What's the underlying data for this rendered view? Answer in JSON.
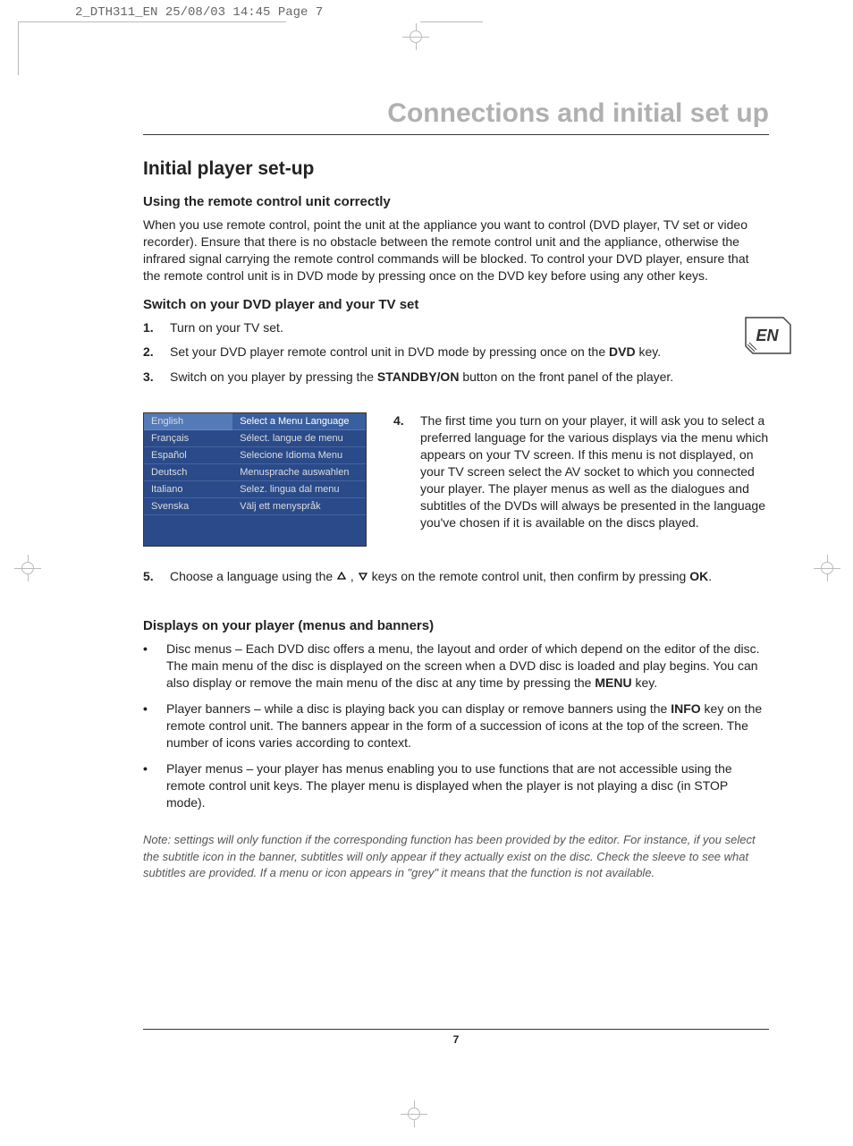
{
  "print_header": "2_DTH311_EN  25/08/03  14:45  Page 7",
  "main_title": "Connections and initial set up",
  "section_title": "Initial player set-up",
  "lang_badge": "EN",
  "sub1": {
    "heading": "Using the remote control unit correctly",
    "body": "When you use remote control, point the unit at the appliance you want to control (DVD player, TV set or video recorder). Ensure that there is no obstacle between the remote control unit and the appliance, otherwise the infrared signal carrying the remote control commands will be blocked. To control your DVD player, ensure that the remote control unit is in DVD mode by pressing once on the DVD key before using any other keys."
  },
  "sub2": {
    "heading": "Switch on your DVD player and your TV set",
    "steps": [
      {
        "n": "1.",
        "t": "Turn on your TV set."
      },
      {
        "n": "2.",
        "pre": "Set your DVD player remote control unit in DVD mode by pressing once on the ",
        "bold": "DVD",
        "post": " key."
      },
      {
        "n": "3.",
        "pre": "Switch on you player by pressing the ",
        "bold": "STANDBY/ON",
        "post": " button on the front panel of the player."
      }
    ],
    "step4": {
      "n": "4.",
      "t": "The first time you turn on your player, it will ask you to select a preferred language for the various displays via the menu which appears on your TV screen. If this menu is not displayed, on your TV screen select the AV socket to which you connected your player. The player menus as well as the dialogues and subtitles of the DVDs will always be presented in the language you've chosen if it is available on the discs played."
    },
    "step5": {
      "n": "5.",
      "pre": "Choose a language using the ",
      "mid": " keys on the remote control unit, then confirm by pressing ",
      "bold": "OK",
      "post": "."
    }
  },
  "lang_menu": {
    "rows": [
      {
        "l": "English",
        "r": "Select a Menu Language",
        "sel": true
      },
      {
        "l": "Français",
        "r": "Sélect. langue de menu"
      },
      {
        "l": "Español",
        "r": "Selecione Idioma Menu"
      },
      {
        "l": "Deutsch",
        "r": "Menusprache auswahlen"
      },
      {
        "l": "Italiano",
        "r": "Selez. lingua dal menu"
      },
      {
        "l": "Svenska",
        "r": "Välj ett menyspråk"
      }
    ]
  },
  "sub3": {
    "heading": "Displays on your player (menus and banners)",
    "bullets": [
      {
        "pre": "Disc menus – Each DVD disc offers a menu, the layout and order of which depend on the editor of the disc. The main menu of the disc is displayed on the screen when a DVD disc is loaded and play begins. You can also display or remove the main menu of the disc at any time by pressing the ",
        "bold": "MENU",
        "post": " key."
      },
      {
        "pre": "Player banners – while a disc is playing back you can display or remove banners using the ",
        "bold": "INFO",
        "post": " key on the remote control unit. The banners appear in the form of a succession of icons at the top of the screen. The number of icons varies according to context."
      },
      {
        "pre": "Player menus – your player has menus enabling you to use functions that are not accessible using the remote control unit keys. The player menu is displayed when the player is not playing a disc (in STOP mode).",
        "bold": "",
        "post": ""
      }
    ]
  },
  "note": "Note: settings will only function if the corresponding function has been provided by the editor. For instance, if you select the subtitle icon in the banner, subtitles will only appear if they actually exist on the disc. Check the sleeve to see what subtitles are provided. If a menu or icon appears in \"grey\" it means that the function is not available.",
  "page_number": "7"
}
